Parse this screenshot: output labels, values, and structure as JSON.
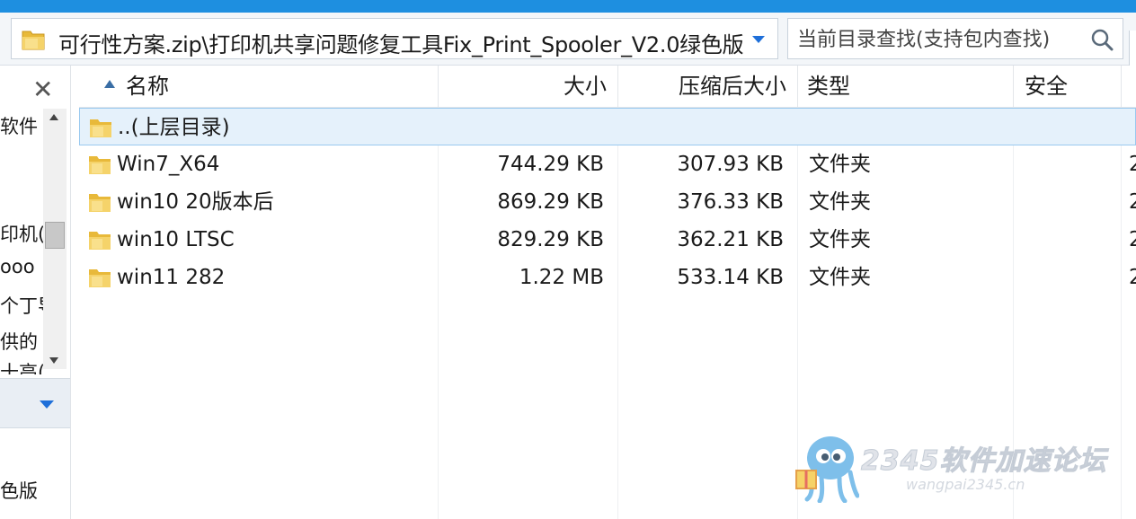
{
  "address": {
    "path": "可行性方案.zip\\打印机共享问题修复工具Fix_Print_Spooler_V2.0绿色版",
    "search_placeholder": "当前目录查找(支持包内查找)"
  },
  "nav": {
    "items": [
      "软件",
      "印机(",
      "ooo",
      "个丁导",
      "供的",
      "十高(",
      "色版"
    ]
  },
  "columns": {
    "name": "名称",
    "size": "大小",
    "compressed": "压缩后大小",
    "type": "类型",
    "security": "安全"
  },
  "rows": [
    {
      "name": "..(上层目录)",
      "size": "",
      "compressed": "",
      "type": "",
      "extra": ""
    },
    {
      "name": "Win7_X64",
      "size": "744.29 KB",
      "compressed": "307.93 KB",
      "type": "文件夹",
      "extra": "2"
    },
    {
      "name": "win10 20版本后",
      "size": "869.29 KB",
      "compressed": "376.33 KB",
      "type": "文件夹",
      "extra": "2"
    },
    {
      "name": "win10 LTSC",
      "size": "829.29 KB",
      "compressed": "362.21 KB",
      "type": "文件夹",
      "extra": "2"
    },
    {
      "name": "win11 282",
      "size": "1.22 MB",
      "compressed": "533.14 KB",
      "type": "文件夹",
      "extra": "2"
    }
  ],
  "watermark": {
    "title": "2345软件加速论坛",
    "url": "wangpai2345.cn"
  },
  "colors": {
    "accent": "#1e8fe0",
    "selection": "#e5f1fb",
    "folder": "#e8b93a"
  }
}
